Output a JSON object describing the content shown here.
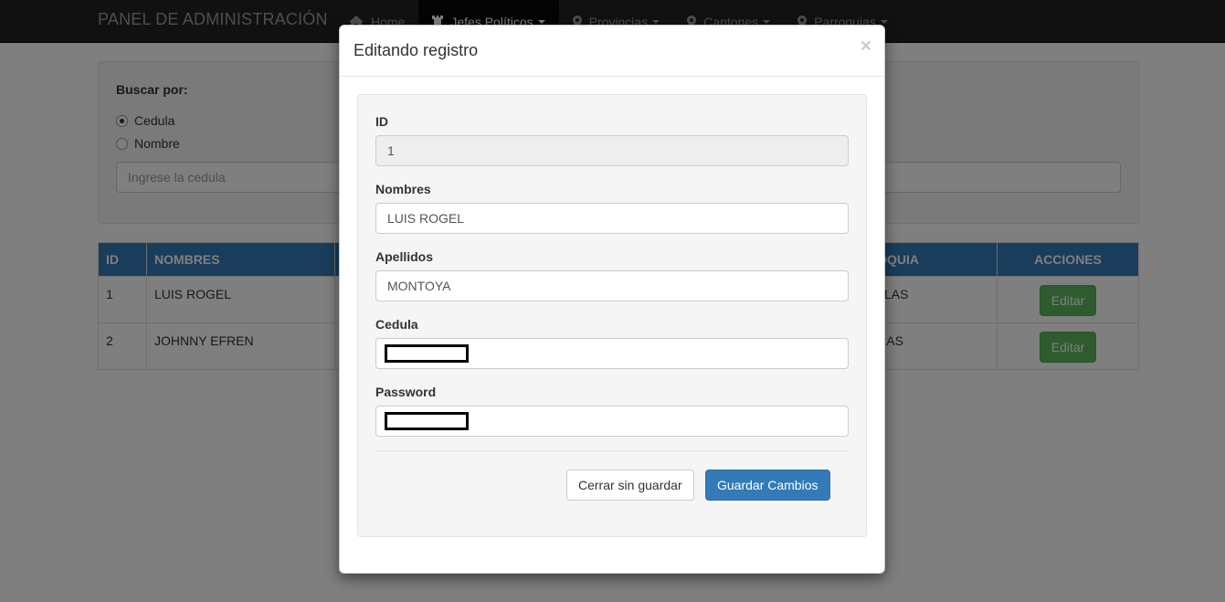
{
  "navbar": {
    "brand": "PANEL DE ADMINISTRACIÓN",
    "items": [
      {
        "label": "Home",
        "icon": "home-icon",
        "dropdown": false,
        "active": false
      },
      {
        "label": "Jefes Políticos",
        "icon": "rook-icon",
        "dropdown": true,
        "active": true
      },
      {
        "label": "Provincias",
        "icon": "map-marker-icon",
        "dropdown": true,
        "active": false
      },
      {
        "label": "Cantones",
        "icon": "map-marker-icon",
        "dropdown": true,
        "active": false
      },
      {
        "label": "Parroquias",
        "icon": "map-marker-icon",
        "dropdown": true,
        "active": false
      }
    ]
  },
  "search": {
    "title": "Buscar por:",
    "options": [
      {
        "label": "Cedula",
        "checked": true
      },
      {
        "label": "Nombre",
        "checked": false
      }
    ],
    "placeholder": "Ingrese la cedula"
  },
  "table": {
    "headers": [
      "ID",
      "NOMBRES",
      "",
      "OQUIA",
      "ACCIONES"
    ],
    "rows": [
      {
        "id": "1",
        "nombres": "LUIS ROGEL",
        "col3": "",
        "parroquia": "LLAS",
        "action": "Editar"
      },
      {
        "id": "2",
        "nombres": "JOHNNY EFREN",
        "col3": "",
        "parroquia": "RAS",
        "action": "Editar"
      }
    ]
  },
  "modal": {
    "title": "Editando registro",
    "close": "×",
    "fields": {
      "id": {
        "label": "ID",
        "value": "1"
      },
      "nombres": {
        "label": "Nombres",
        "value": "LUIS ROGEL"
      },
      "apellidos": {
        "label": "Apellidos",
        "value": "MONTOYA"
      },
      "cedula": {
        "label": "Cedula",
        "value": ""
      },
      "password": {
        "label": "Password",
        "value": ""
      }
    },
    "buttons": {
      "cancel": "Cerrar sin guardar",
      "save": "Guardar Cambios"
    }
  },
  "colors": {
    "navbar": "#222222",
    "primary": "#337ab7",
    "success": "#5cb85c",
    "backdrop": "rgba(0,0,0,0.5)"
  }
}
